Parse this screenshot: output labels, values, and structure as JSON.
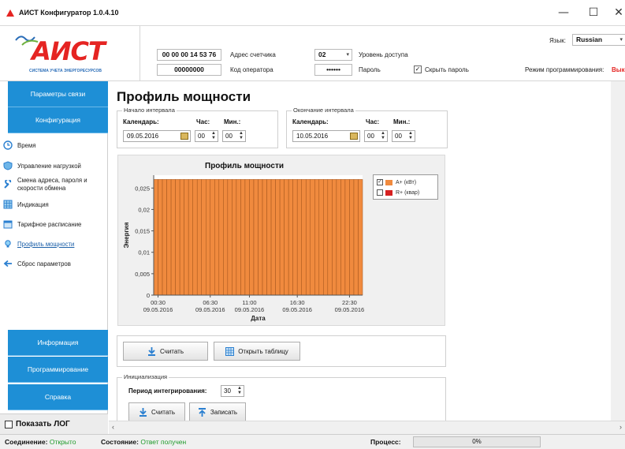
{
  "window": {
    "title": "АИСТ Конфигуратор 1.0.4.10",
    "minimize": "—",
    "maximize": "☐",
    "close": "✕"
  },
  "header": {
    "logo_text": "АИСТ",
    "logo_subtitle": "СИСТЕМА УЧЕТА ЭНЕРГОРЕСУРСОВ",
    "meter_address_value": "00 00 00 14 53 76",
    "meter_address_label": "Адрес счетчика",
    "operator_code_value": "00000000",
    "operator_code_label": "Код оператора",
    "access_level_value": "02",
    "access_level_label": "Уровень доступа",
    "password_value": "••••••",
    "password_label": "Пароль",
    "hide_password_label": "Скрыть пароль",
    "hide_password_checked": true,
    "language_label": "Язык:",
    "language_value": "Russian",
    "mode_label": "Режим программирования:",
    "mode_value": "Вык"
  },
  "sidebar": {
    "top_buttons": [
      {
        "label": "Параметры связи"
      },
      {
        "label": "Конфигурация"
      }
    ],
    "items": [
      {
        "label": "Время",
        "icon": "clock-icon"
      },
      {
        "label": "Управление нагрузкой",
        "icon": "shield-icon"
      },
      {
        "label": "Смена адреса, пароля и",
        "label2": "скорости обмена",
        "icon": "wrench-icon"
      },
      {
        "label": "Индикация",
        "icon": "grid-icon"
      },
      {
        "label": "Тарифное расписание",
        "icon": "calendar-icon"
      },
      {
        "label": "Профиль мощности",
        "icon": "lightbulb-icon",
        "active": true
      },
      {
        "label": "Сброс параметров",
        "icon": "back-arrow-icon"
      }
    ],
    "bottom_buttons": [
      {
        "label": "Информация"
      },
      {
        "label": "Программирование"
      },
      {
        "label": "Справка"
      }
    ],
    "show_log_label": "Показать ЛОГ"
  },
  "main": {
    "page_title": "Профиль мощности",
    "start": {
      "caption": "Начало интервала",
      "calendar_label": "Календарь:",
      "hour_label": "Час:",
      "min_label": "Мин.:",
      "date": "09.05.2016",
      "hour": "00",
      "min": "00"
    },
    "end": {
      "caption": "Окончание интервала",
      "calendar_label": "Календарь:",
      "hour_label": "Час:",
      "min_label": "Мин.:",
      "date": "10.05.2016",
      "hour": "00",
      "min": "00"
    },
    "read_button": "Считать",
    "open_table_button": "Открыть таблицу",
    "init": {
      "caption": "Инициализация",
      "period_label": "Период интегрирования:",
      "period_value": "30",
      "read_button": "Считать",
      "write_button": "Записать"
    }
  },
  "chart_data": {
    "type": "bar",
    "title": "Профиль мощности",
    "xlabel": "Дата",
    "ylabel": "Энергия",
    "ylim": [
      0,
      0.028
    ],
    "yticks": [
      "0",
      "0,005",
      "0,01",
      "0,015",
      "0,02",
      "0,025"
    ],
    "ytick_values": [
      0,
      0.005,
      0.01,
      0.015,
      0.02,
      0.025
    ],
    "xticks": [
      {
        "time": "00:30",
        "date": "09.05.2016"
      },
      {
        "time": "06:30",
        "date": "09.05.2016"
      },
      {
        "time": "11:00",
        "date": "09.05.2016"
      },
      {
        "time": "16:30",
        "date": "09.05.2016"
      },
      {
        "time": "22:30",
        "date": "09.05.2016"
      }
    ],
    "bar_count": 48,
    "series": [
      {
        "name": "A+ (кВт)",
        "color": "#f08a3e",
        "value": 0.027,
        "visible": true
      },
      {
        "name": "R+ (квар)",
        "color": "#d62020",
        "visible": false
      }
    ],
    "legend_position": "top-right",
    "grid": false
  },
  "status": {
    "connection_label": "Соединение:",
    "connection_value": "Открыто",
    "state_label": "Состояние:",
    "state_value": "Ответ получен",
    "process_label": "Процесс:",
    "progress_value": "0%",
    "progress_fraction": 0
  },
  "colors": {
    "sidebar_button": "#1e8fd6",
    "status_ok": "#1e9a2a",
    "bar": "#f08a3e",
    "logo_red": "#e52422"
  }
}
